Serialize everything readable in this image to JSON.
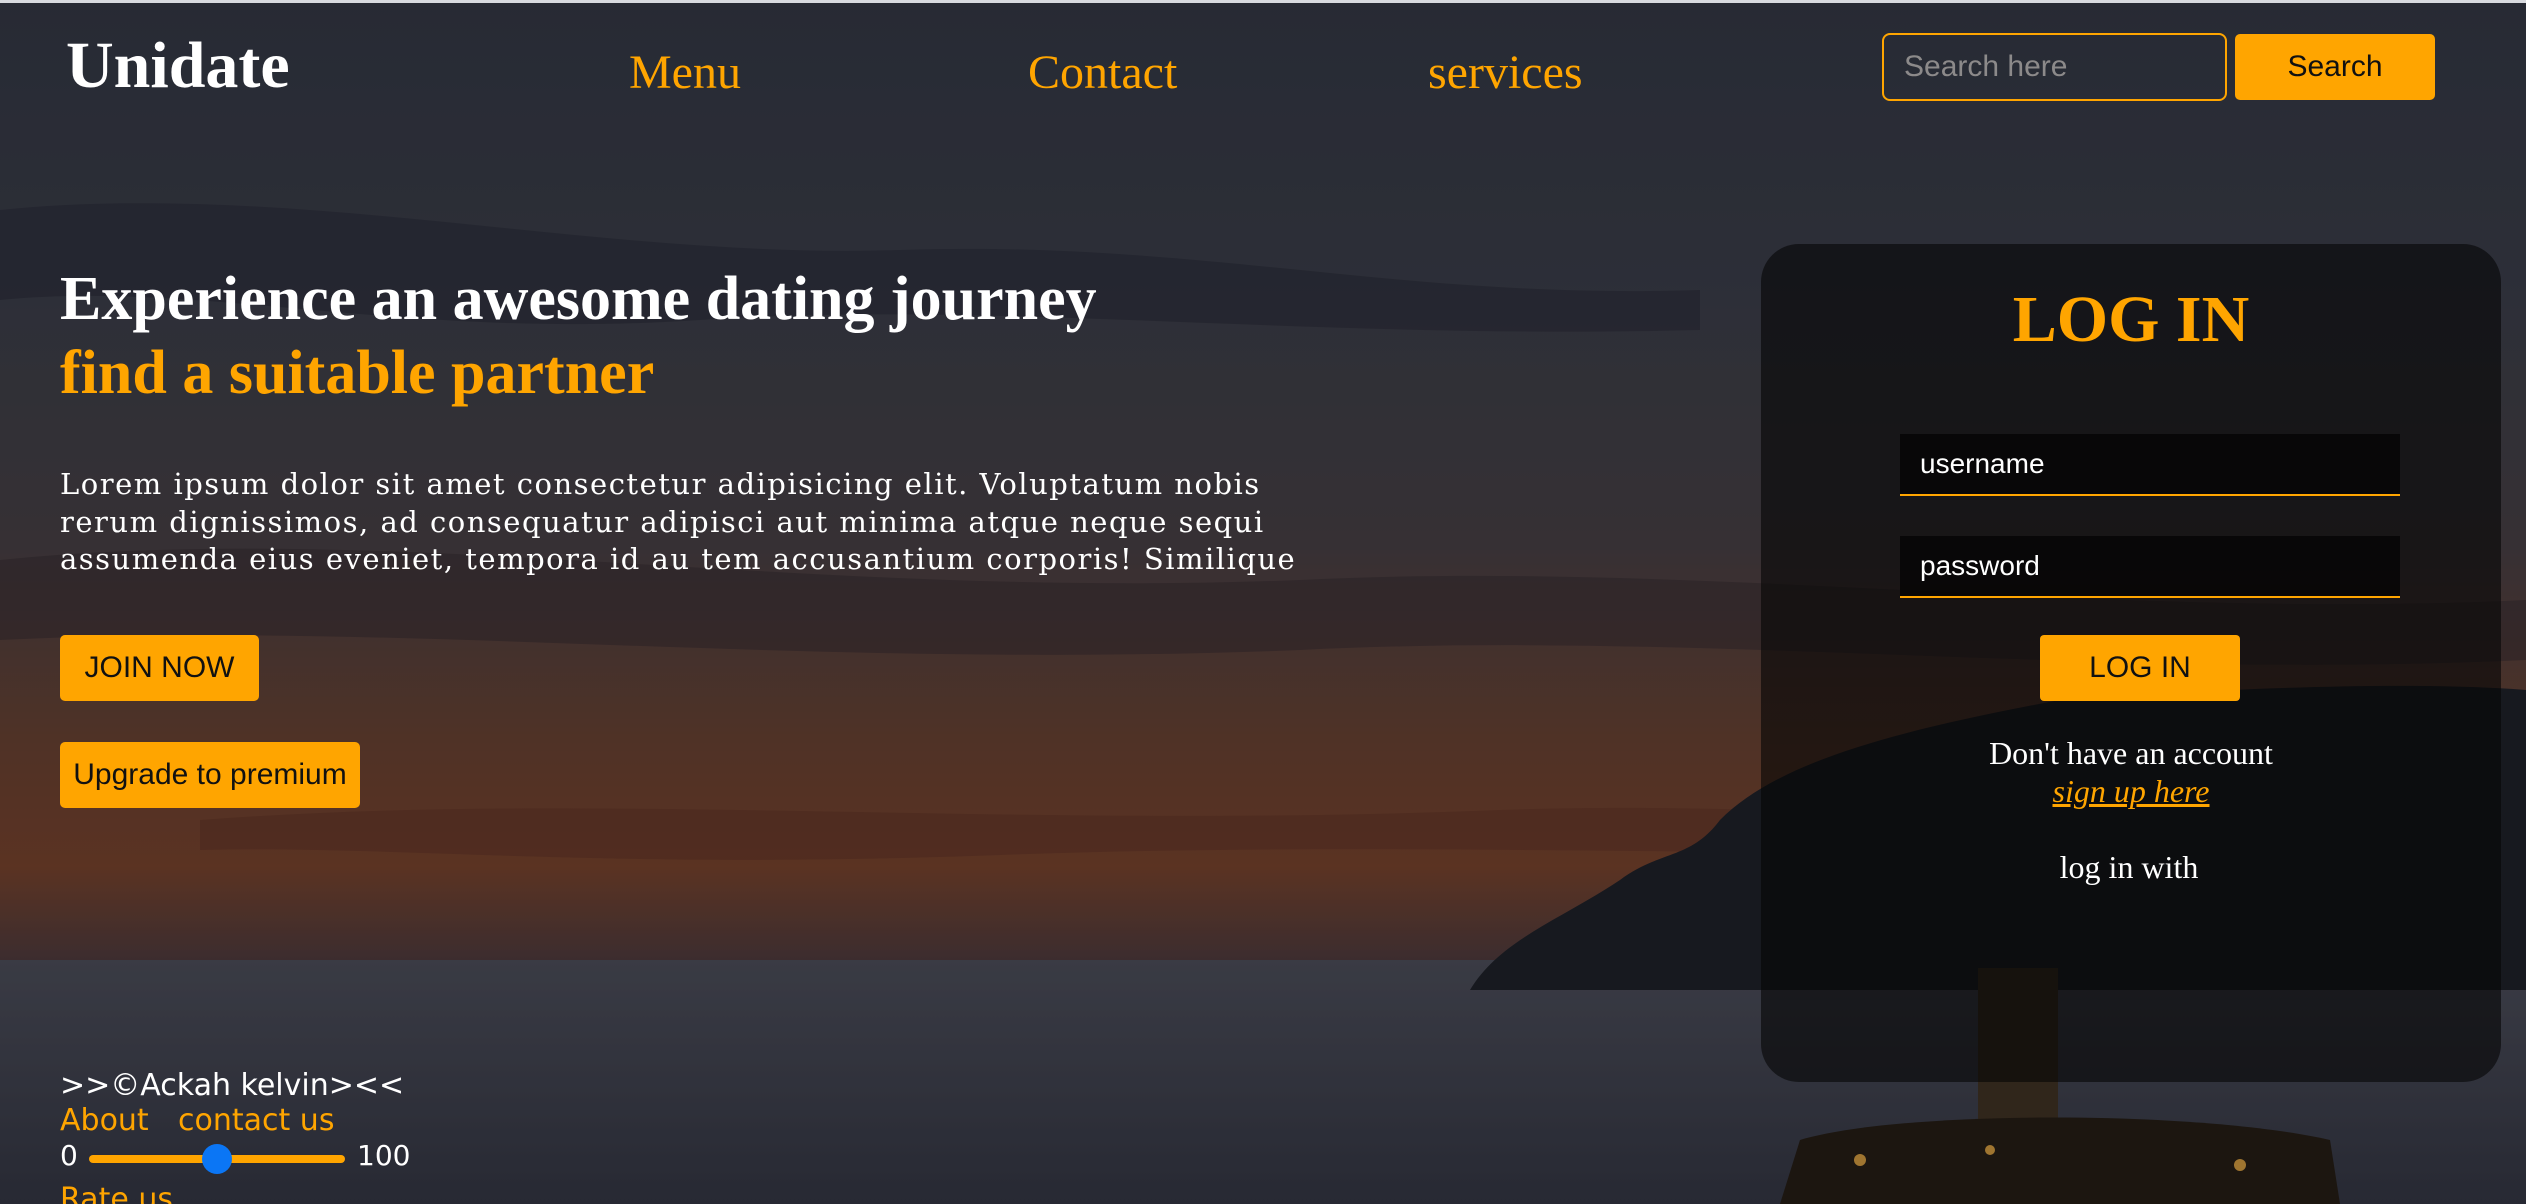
{
  "header": {
    "logo": "Unidate",
    "nav": {
      "menu": "Menu",
      "contact": "Contact",
      "services": "services"
    },
    "search": {
      "placeholder": "Search here",
      "value": "",
      "button_label": "Search"
    }
  },
  "hero": {
    "title": "Experience an awesome dating journey",
    "subtitle": "find a suitable partner",
    "text_lines": [
      "Lorem ipsum dolor sit amet consectetur adipisicing elit. Voluptatum nobis",
      "rerum dignissimos, ad consequatur adipisci aut minima atque neque sequi",
      "assumenda eius eveniet, tempora id au tem accusantium corporis! Similique"
    ],
    "join_button": "JOIN NOW",
    "premium_button": "Upgrade to premium"
  },
  "footer": {
    "copyright": ">>©Ackah kelvin><<",
    "about": "About",
    "contact": "contact us",
    "rating": {
      "min_label": "0",
      "max_label": "100",
      "min": 0,
      "max": 100,
      "value": 50
    },
    "rate_us": "Rate us"
  },
  "login": {
    "title": "LOG IN",
    "username_placeholder": "username",
    "password_placeholder": "password",
    "button_label": "LOG IN",
    "no_account_text": "Don't have an account",
    "signup_link": "sign up here",
    "login_with": "log in with"
  },
  "colors": {
    "accent": "#ffa500",
    "slider_thumb": "#0b76f5",
    "text": "#ffffff"
  }
}
